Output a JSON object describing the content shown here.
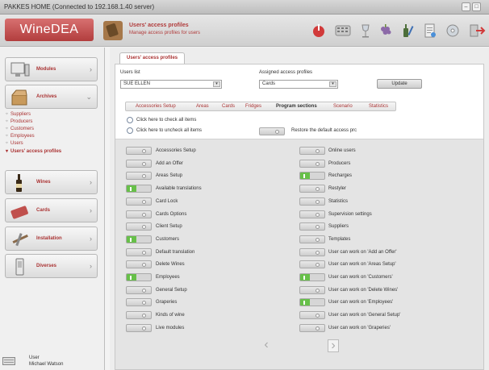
{
  "window": {
    "title": "PAKKES HOME (Connected to 192.168.1.40 server)"
  },
  "brand": {
    "logo_text": "WineDEA",
    "accent": "#b23d3d"
  },
  "header": {
    "title": "Users' access profiles",
    "subtitle": "Manage access profiles for users",
    "toolbar_icons": [
      "power-icon",
      "keypad-icon",
      "glass-icon",
      "grapes-icon",
      "bottle-pen-icon",
      "document-icon",
      "disc-icon",
      "exit-icon"
    ]
  },
  "sidebar": {
    "categories": [
      {
        "label": "Modules",
        "icon": "monitor-icon"
      },
      {
        "label": "Archives",
        "icon": "box-icon"
      },
      {
        "label": "Wines",
        "icon": "wine-bottle-icon"
      },
      {
        "label": "Cards",
        "icon": "card-icon"
      },
      {
        "label": "Installation",
        "icon": "tools-icon"
      },
      {
        "label": "Diverses",
        "icon": "phone-icon"
      }
    ],
    "archive_items": [
      "Suppliers",
      "Producers",
      "Customers",
      "Employees",
      "Users",
      "Users' access profiles"
    ],
    "user": {
      "label": "User",
      "name": "Michael Watson"
    }
  },
  "main": {
    "tab_label": "Users' access profiles",
    "users_list_label": "Users list",
    "users_list_value": "SUE ELLEN",
    "assigned_label": "Assigned access profiles",
    "assigned_value": "Cards",
    "update_label": "Update",
    "subtabs": [
      "Accessories Setup",
      "Areas",
      "Cards",
      "Fridges",
      "Program sections",
      "Scenario",
      "Statistics"
    ],
    "active_subtab": "Program sections",
    "check_all_label": "Click here to check all items",
    "uncheck_all_label": "Click here to uncheck all items",
    "restore_label": "Restore the default access prc",
    "left_items": [
      {
        "label": "Accessories Setup",
        "on": false
      },
      {
        "label": "Add an Offer",
        "on": false
      },
      {
        "label": "Areas Setup",
        "on": false
      },
      {
        "label": "Available translations",
        "on": true
      },
      {
        "label": "Card Lock",
        "on": false
      },
      {
        "label": "Cards Options",
        "on": false
      },
      {
        "label": "Client Setup",
        "on": false
      },
      {
        "label": "Customers",
        "on": true
      },
      {
        "label": "Default translation",
        "on": false
      },
      {
        "label": "Delete Wines",
        "on": false
      },
      {
        "label": "Employees",
        "on": true
      },
      {
        "label": "General Setup",
        "on": false
      },
      {
        "label": "Graperies",
        "on": false
      },
      {
        "label": "Kinds of wine",
        "on": false
      },
      {
        "label": "Live modules",
        "on": false
      }
    ],
    "right_items": [
      {
        "label": "Online users",
        "on": false
      },
      {
        "label": "Producers",
        "on": false
      },
      {
        "label": "Recharges",
        "on": true
      },
      {
        "label": "Restyler",
        "on": false
      },
      {
        "label": "Statistics",
        "on": false
      },
      {
        "label": "Supervision settings",
        "on": false
      },
      {
        "label": "Suppliers",
        "on": false
      },
      {
        "label": "Templates",
        "on": false
      },
      {
        "label": "User can work on 'Add an Offer'",
        "on": false
      },
      {
        "label": "User can work on 'Areas Setup'",
        "on": false
      },
      {
        "label": "User can work on 'Customers'",
        "on": true
      },
      {
        "label": "User can work on 'Delete Wines'",
        "on": false
      },
      {
        "label": "User can work on 'Employees'",
        "on": true
      },
      {
        "label": "User can work on 'General Setup'",
        "on": false
      },
      {
        "label": "User can work on 'Graperies'",
        "on": false
      }
    ],
    "pager": {
      "prev": "‹",
      "next": "›"
    }
  }
}
